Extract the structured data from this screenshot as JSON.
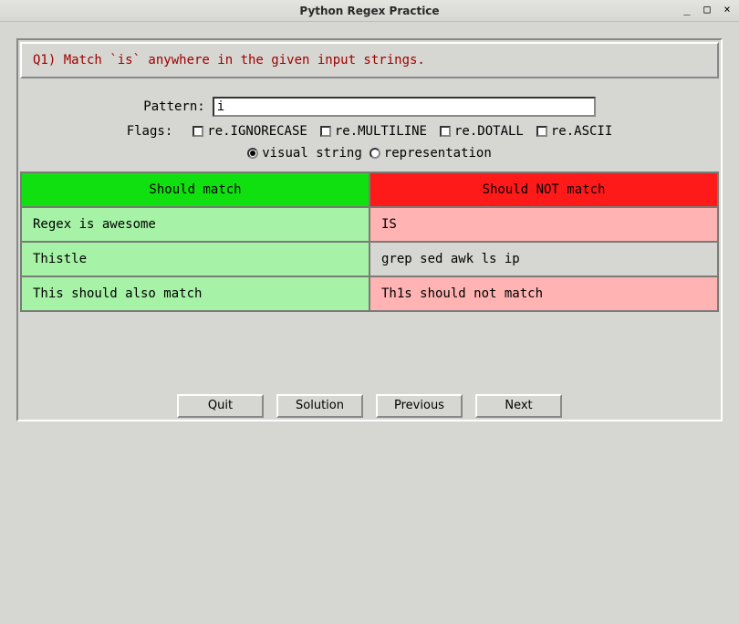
{
  "window": {
    "title": "Python Regex Practice",
    "minimize": "_",
    "maximize": "□",
    "close": "×"
  },
  "question": "Q1) Match `is` anywhere in the given input strings.",
  "pattern": {
    "label": "Pattern:",
    "value": "i"
  },
  "flags": {
    "label": "Flags:",
    "items": [
      {
        "label": "re.IGNORECASE",
        "checked": false
      },
      {
        "label": "re.MULTILINE",
        "checked": false
      },
      {
        "label": "re.DOTALL",
        "checked": false
      },
      {
        "label": "re.ASCII",
        "checked": false
      }
    ]
  },
  "view": {
    "options": [
      {
        "label": "visual string",
        "selected": true
      },
      {
        "label": "representation",
        "selected": false
      }
    ]
  },
  "headers": {
    "match": "Should match",
    "nomatch": "Should NOT match"
  },
  "rows": [
    {
      "match": "Regex is awesome",
      "nomatch": "IS",
      "nomatch_state": "hit"
    },
    {
      "match": "Thistle",
      "nomatch": "grep sed awk ls ip",
      "nomatch_state": "ok"
    },
    {
      "match": "This should also match",
      "nomatch": "Th1s should not match",
      "nomatch_state": "hit"
    }
  ],
  "buttons": {
    "quit": "Quit",
    "solution": "Solution",
    "previous": "Previous",
    "next": "Next"
  }
}
